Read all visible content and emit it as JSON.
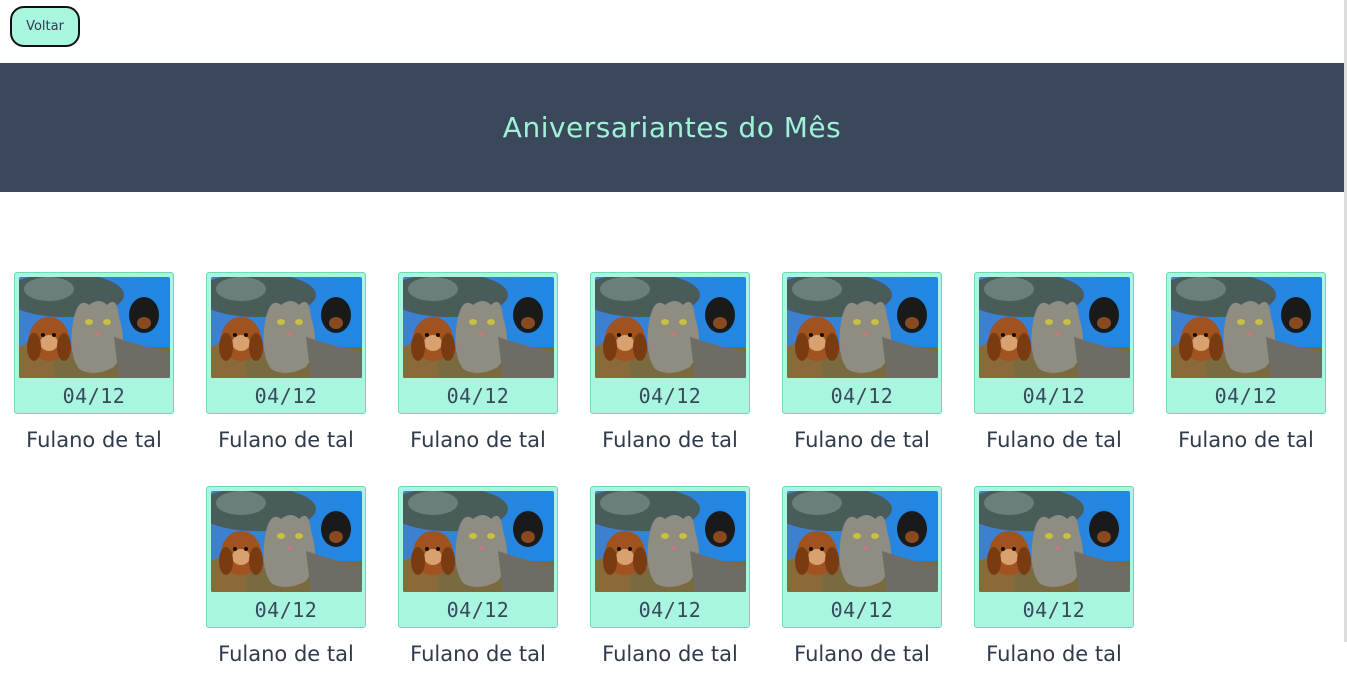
{
  "back_button": {
    "label": "Voltar"
  },
  "header": {
    "title": "Aniversariantes do Mês"
  },
  "colors": {
    "header_bg": "#3b485c",
    "accent": "#a8f5e0",
    "title_text": "#9ef3d6",
    "dark_text": "#2f3a4a"
  },
  "people": [
    {
      "date": "04/12",
      "name": "Fulano de tal",
      "photo": "cat-dogs-selfie-photo"
    },
    {
      "date": "04/12",
      "name": "Fulano de tal",
      "photo": "cat-dogs-selfie-photo"
    },
    {
      "date": "04/12",
      "name": "Fulano de tal",
      "photo": "cat-dogs-selfie-photo"
    },
    {
      "date": "04/12",
      "name": "Fulano de tal",
      "photo": "cat-dogs-selfie-photo"
    },
    {
      "date": "04/12",
      "name": "Fulano de tal",
      "photo": "cat-dogs-selfie-photo"
    },
    {
      "date": "04/12",
      "name": "Fulano de tal",
      "photo": "cat-dogs-selfie-photo"
    },
    {
      "date": "04/12",
      "name": "Fulano de tal",
      "photo": "cat-dogs-selfie-photo"
    },
    {
      "date": "04/12",
      "name": "Fulano de tal",
      "photo": "cat-dogs-selfie-photo"
    },
    {
      "date": "04/12",
      "name": "Fulano de tal",
      "photo": "cat-dogs-selfie-photo"
    },
    {
      "date": "04/12",
      "name": "Fulano de tal",
      "photo": "cat-dogs-selfie-photo"
    },
    {
      "date": "04/12",
      "name": "Fulano de tal",
      "photo": "cat-dogs-selfie-photo"
    },
    {
      "date": "04/12",
      "name": "Fulano de tal",
      "photo": "cat-dogs-selfie-photo"
    }
  ]
}
